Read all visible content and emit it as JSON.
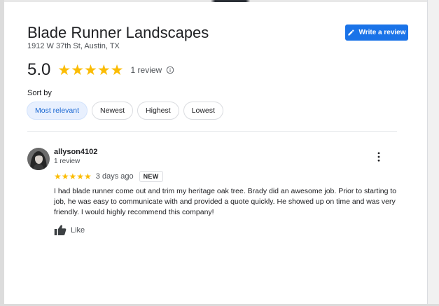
{
  "business": {
    "name": "Blade Runner Landscapes",
    "address": "1912 W 37th St, Austin, TX"
  },
  "write_review": {
    "label": "Write a review",
    "icon": "pencil-icon"
  },
  "rating": {
    "value": "5.0",
    "stars": 5,
    "count_label": "1 review",
    "info_icon": "info-icon"
  },
  "sort": {
    "label": "Sort by",
    "options": [
      "Most relevant",
      "Newest",
      "Highest",
      "Lowest"
    ],
    "selected": "Most relevant"
  },
  "reviews": [
    {
      "author": "allyson4102",
      "author_review_count": "1 review",
      "stars": 5,
      "date": "3 days ago",
      "badge": "NEW",
      "text": "I had blade runner come out and trim my heritage oak tree. Brady did an awesome job. Prior to starting to job, he was easy to communicate with and provided a quote  quickly. He showed up on time and was very friendly. I would highly recommend this company!",
      "like_label": "Like"
    }
  ],
  "colors": {
    "accent": "#1a73e8",
    "star": "#fbbc04",
    "chip_active_bg": "#e8f0fe",
    "chip_active_text": "#1967d2"
  }
}
